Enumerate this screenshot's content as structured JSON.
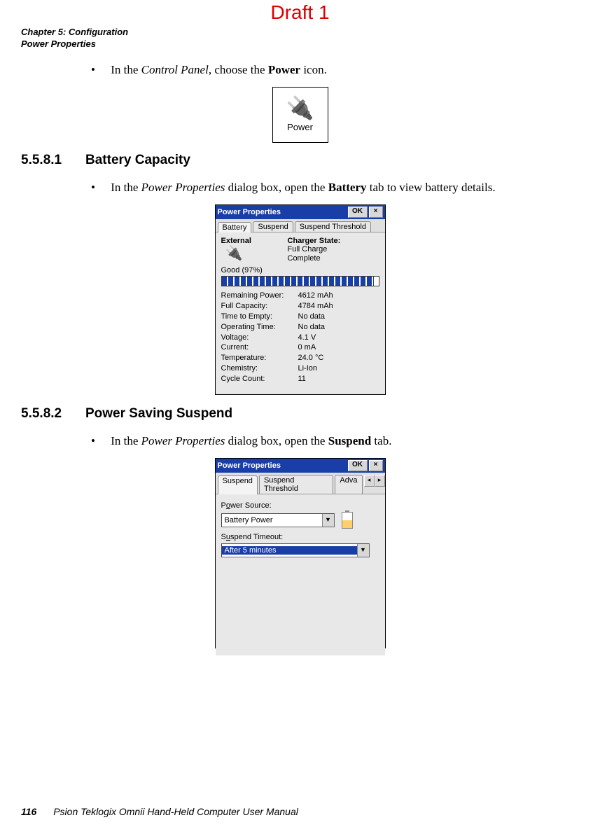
{
  "draft": "Draft 1",
  "header": {
    "line1": "Chapter 5: Configuration",
    "line2": "Power Properties"
  },
  "bullet1": {
    "pre": "In the ",
    "ital": "Control Panel",
    "mid": ", choose the ",
    "bold": "Power",
    "post": " icon."
  },
  "powerIcon": {
    "label": "Power"
  },
  "sec1": {
    "num": "5.5.8.1",
    "title": "Battery Capacity"
  },
  "bullet2": {
    "pre": "In the ",
    "ital": "Power Properties",
    "mid": " dialog box, open the ",
    "bold": "Battery",
    "post": " tab to view battery details."
  },
  "dlg1": {
    "title": "Power Properties",
    "ok": "OK",
    "close": "×",
    "tabs": {
      "t1": "Battery",
      "t2": "Suspend",
      "t3": "Suspend Threshold"
    },
    "external": "External",
    "chargerState": "Charger State:",
    "chg1": "Full Charge",
    "chg2": "Complete",
    "good": "Good  (97%)",
    "stats": [
      {
        "k": "Remaining Power:",
        "v": "4612 mAh"
      },
      {
        "k": "Full Capacity:",
        "v": "4784 mAh"
      },
      {
        "k": "Time to Empty:",
        "v": "No data"
      },
      {
        "k": "Operating Time:",
        "v": "No data"
      },
      {
        "k": "Voltage:",
        "v": "4.1 V"
      },
      {
        "k": "Current:",
        "v": "0 mA"
      },
      {
        "k": "Temperature:",
        "v": "24.0 °C"
      },
      {
        "k": "Chemistry:",
        "v": "Li-Ion"
      },
      {
        "k": "Cycle Count:",
        "v": "11"
      }
    ]
  },
  "sec2": {
    "num": "5.5.8.2",
    "title": "Power Saving Suspend"
  },
  "bullet3": {
    "pre": "In the ",
    "ital": "Power Properties",
    "mid": " dialog box, open the ",
    "bold": "Suspend",
    "post": " tab."
  },
  "dlg2": {
    "title": "Power Properties",
    "ok": "OK",
    "close": "×",
    "tabs": {
      "t1": "Suspend",
      "t2": "Suspend Threshold",
      "t3": "Adva",
      "left": "◂",
      "right": "▸"
    },
    "lbl1_pre": "P",
    "lbl1_u": "o",
    "lbl1_post": "wer Source:",
    "combo1": "Battery Power",
    "lbl2_pre": "S",
    "lbl2_u": "u",
    "lbl2_post": "spend Timeout:",
    "combo2": "After 5 minutes"
  },
  "footer": {
    "page": "116",
    "text": "Psion Teklogix Omnii Hand-Held Computer User Manual"
  }
}
